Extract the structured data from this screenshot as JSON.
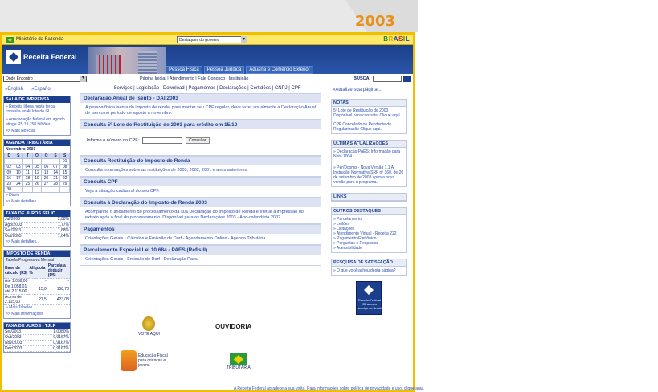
{
  "year": "2003",
  "govbar": {
    "ministry": "Ministério da Fazenda",
    "select_value": "Destaques do governo",
    "brasil": [
      "B",
      "R",
      "A",
      "S",
      "I",
      "L"
    ]
  },
  "banner": {
    "logo": "Receita Federal",
    "tabs": [
      "Pessoa Física",
      "Pessoa Jurídica",
      "Aduana e Comércio Exterior"
    ]
  },
  "nav": {
    "select_value": "Onde Encontro",
    "links": "Página Inicial | Atendimento | Fale Conosco | Instituição",
    "busca_label": "BUSCA:",
    "services": "Serviços | Legislação | Download | Pagamentos | Declarações | Certidões | CNPJ | CPF"
  },
  "left": {
    "lang": [
      "»English",
      "»Español"
    ],
    "press": {
      "title": "SALA DE IMPRENSA",
      "items": [
        "» Receita libera nesta terça consulta ao 4º lote do IR.",
        "» Arrecadação federal em agosto atinge R$ 19,758 bilhões."
      ],
      "more": ">> Mais Notícias"
    },
    "agenda": {
      "title": "AGENDA TRIBUTÁRIA",
      "month": "Novembro 2003",
      "days_header": [
        "D",
        "S",
        "T",
        "Q",
        "Q",
        "S",
        "S"
      ],
      "rows": [
        [
          "",
          "",
          "",
          "",
          "",
          "",
          "01"
        ],
        [
          "02",
          "03",
          "04",
          "05",
          "06",
          "07",
          "08"
        ],
        [
          "09",
          "10",
          "11",
          "12",
          "13",
          "14",
          "15"
        ],
        [
          "16",
          "17",
          "18",
          "19",
          "20",
          "21",
          "22"
        ],
        [
          "23",
          "24",
          "25",
          "26",
          "27",
          "28",
          "29"
        ],
        [
          "30",
          "",
          "",
          "",
          "",
          "",
          ""
        ]
      ],
      "links": [
        "» Diário",
        ">> Mais detalhes"
      ]
    },
    "selic": {
      "title": "TAXA DE JUROS SELIC",
      "rows": [
        [
          "Jul/2003",
          "2,08%"
        ],
        [
          "Ago/2003",
          "1,77%"
        ],
        [
          "Set/2003",
          "1,68%"
        ],
        [
          "Out/2003",
          "1,64%"
        ]
      ],
      "more": ">> Mais detalhes..."
    },
    "renda": {
      "title": "IMPOSTO DE RENDA",
      "subtitle": "Tabela Progressiva Mensal",
      "headers": [
        "Base de cálculo (R$)",
        "Alíquota %",
        "Parcela a deduzir (R$)"
      ],
      "rows": [
        [
          "Até 1.058,00",
          "-",
          "-"
        ],
        [
          "De 1.058,01 até 2.115,00",
          "15,0",
          "158,70"
        ],
        [
          "Acima de 2.115,00",
          "27,5",
          "423,08"
        ]
      ],
      "links": [
        "» Mais Tabelas",
        ">> Mais Informações"
      ]
    },
    "tjlp": {
      "title": "TAXA DE JUROS - TJLP",
      "rows": [
        [
          "Set/2003",
          "1,0080%"
        ],
        [
          "Out/2003",
          "0,9167%"
        ],
        [
          "Nov/2003",
          "0,9167%"
        ],
        [
          "Dez/2003",
          "0,9167%"
        ]
      ]
    }
  },
  "center": {
    "sections": [
      {
        "title": "Declaração Anual de Isento - DAI 2003",
        "body": "A pessoa física isenta do imposto de renda, para manter seu CPF regular, deve fazer anualmente a Declaração Anual de Isento no período de agosto a novembro."
      },
      {
        "title": "Consulta 5º Lote de Restituição de 2003 para crédito em 15/10",
        "body": ""
      },
      {
        "title": "Consulta Restituição do Imposto de Renda",
        "body": "Consulta informações sobre as restituições de 2003, 2002, 2001 e anos anteriores."
      },
      {
        "title": "Consulta CPF",
        "body": "Veja a situação cadastral do seu CPF."
      },
      {
        "title": "Consulta à Declaração do Imposto de Renda 2003",
        "body": "Acompanhe o andamento do processamento da sua Declaração do Imposto de Renda e efetue a impressão do extrato após o final do processamento. Disponível para as Declarações 2003 - Ano-calendário 2002."
      },
      {
        "title": "Pagamentos",
        "body": "Orientações Gerais - Cálculos e Emissão de Darf - Agendamento Online - Agenda Tributária"
      },
      {
        "title": "Parcelamento Especial Lei 10.684 - PAES (Refis II)",
        "body": "Orientações Gerais - Emissão de Darf - Declaração Paes"
      }
    ],
    "cpf_label": "Informe o número do CPF:",
    "cpf_button": "Consultar",
    "badges": {
      "vote": "VOTE AQUI",
      "ouvidoria": "OUVIDORIA",
      "edu": "Educação Fiscal para crianças e jovens",
      "tributaria": "TRIBUTÁRIA"
    }
  },
  "right": {
    "top_link": "»Atualize sua página...",
    "notas": {
      "title": "NOTAS",
      "items": [
        "5º Lote de Restituição de 2003 Disponível para consulta. Clique aqui.",
        "CPF Cancelado ou Pendente de Regularização Clique aqui."
      ]
    },
    "updates": {
      "title": "ÚLTIMAS ATUALIZAÇÕES",
      "items": [
        "» Declaração PAES: Informação para Nota 1004.",
        "» Per/Dcomp - Nova Versão 1.1 A Instrução Normativa SRF nº 360, de 26 de setembro de 2003 aprova nova versão para o programa."
      ]
    },
    "links": {
      "title": "LINKS"
    },
    "destaques": {
      "title": "OUTROS DESTAQUES",
      "items": [
        "» Parcelamento",
        "» Leilões",
        "» Licitações",
        "» Atendimento Virtual - Receita 222",
        "» Pagamento Eletrônico",
        "» Perguntas e Respostas",
        "» Acessibilidade"
      ]
    },
    "pesquisa": {
      "title": "PESQUISA DE SATISFAÇÃO",
      "body": "» O que você achou desta página?"
    },
    "logo_caption": "Receita Federal 35 anos a serviço do Brasil"
  },
  "footer": "A Receita Federal agradece a sua visita. Para informações sobre política de privacidade e uso, clique aqui."
}
